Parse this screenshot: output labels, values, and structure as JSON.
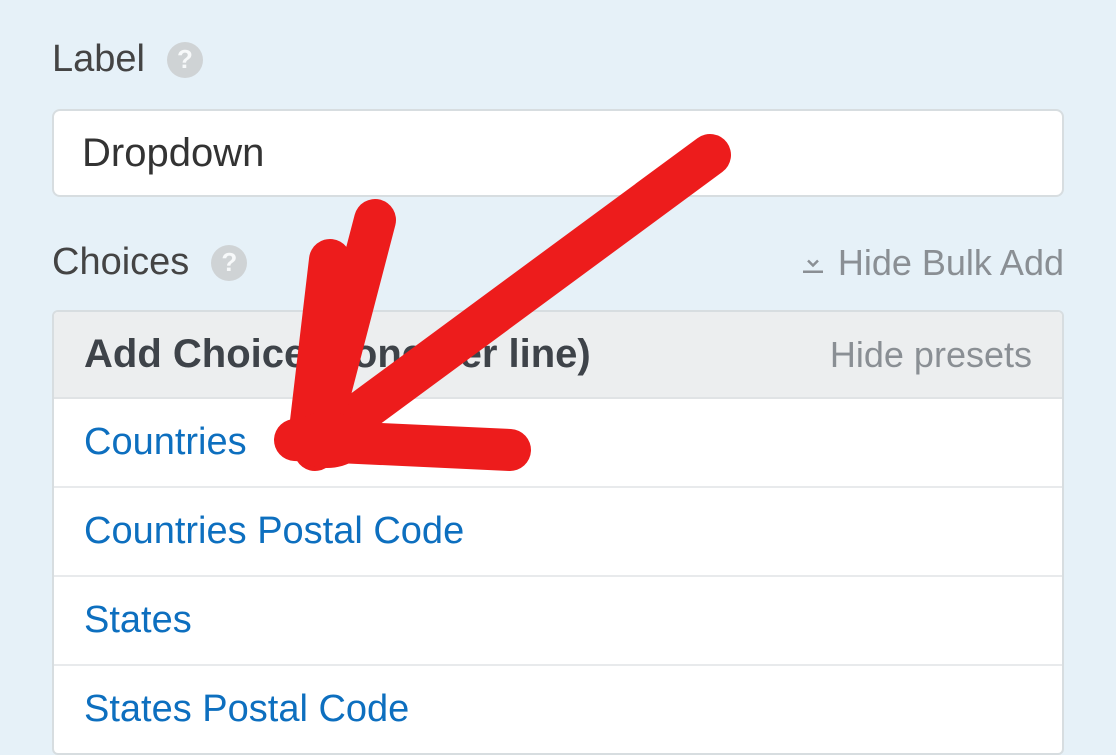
{
  "labelSection": {
    "title": "Label",
    "inputValue": "Dropdown"
  },
  "choicesSection": {
    "title": "Choices",
    "bulkLinkText": "Hide Bulk Add"
  },
  "panel": {
    "title": "Add Choices (one per line)",
    "hidePresets": "Hide presets",
    "presets": [
      "Countries",
      "Countries Postal Code",
      "States",
      "States Postal Code"
    ]
  }
}
